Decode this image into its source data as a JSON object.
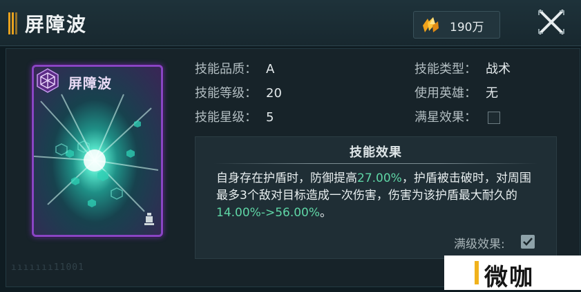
{
  "header": {
    "title": "屏障波",
    "currency_value": "190万",
    "currency_icon": "gold-crystal-icon",
    "close_icon": "close-x-icon"
  },
  "card": {
    "title": "屏障波",
    "badge_icon": "hexagon-badge-icon",
    "corner_icon": "hero-figure-icon"
  },
  "info": {
    "quality_label": "技能品质：",
    "quality_value": "A",
    "level_label": "技能等级：",
    "level_value": "20",
    "star_label": "技能星级：",
    "star_value": "5",
    "type_label": "技能类型：",
    "type_value": "战术",
    "hero_label": "使用英雄：",
    "hero_value": "无",
    "max_star_label": "满星效果：",
    "max_star_checked": false
  },
  "effect": {
    "title": "技能效果",
    "text_1": "自身存在护盾时，防御提高",
    "value_1": "27.00%",
    "text_2": "，护盾被击破时，对周围最多3个敌对目标造成一次伤害，伤害为该护盾最大耐久的",
    "value_2": "14.00%->56.00%",
    "text_3": "。",
    "max_level_label": "满级效果:",
    "max_level_checked": true
  },
  "misc": {
    "faint_text": "ııııııı11001",
    "watermark": "微咖"
  },
  "colors": {
    "accent_orange": "#e8a21f",
    "highlight_green": "#5fd6a6",
    "card_border_purple": "#8a45c4",
    "background": "#0f1c22"
  }
}
